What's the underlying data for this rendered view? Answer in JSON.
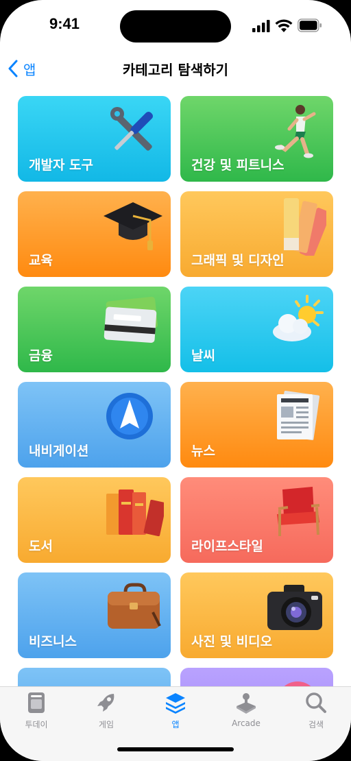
{
  "status_bar": {
    "time": "9:41"
  },
  "nav": {
    "back_label": "앱",
    "title": "카테고리 탐색하기"
  },
  "categories": [
    {
      "label": "개발자 도구",
      "icon": "tools-icon"
    },
    {
      "label": "건강 및 피트니스",
      "icon": "runner-icon"
    },
    {
      "label": "교육",
      "icon": "graduation-cap-icon"
    },
    {
      "label": "그래픽 및 디자인",
      "icon": "color-swatch-icon"
    },
    {
      "label": "금융",
      "icon": "credit-card-icon"
    },
    {
      "label": "날씨",
      "icon": "sun-cloud-icon"
    },
    {
      "label": "내비게이션",
      "icon": "compass-arrow-icon"
    },
    {
      "label": "뉴스",
      "icon": "newspaper-icon"
    },
    {
      "label": "도서",
      "icon": "books-icon"
    },
    {
      "label": "라이프스타일",
      "icon": "armchair-icon"
    },
    {
      "label": "비즈니스",
      "icon": "briefcase-icon"
    },
    {
      "label": "사진 및 비디오",
      "icon": "camera-icon"
    }
  ],
  "tabs": [
    {
      "label": "투데이",
      "icon": "today-icon"
    },
    {
      "label": "게임",
      "icon": "rocket-icon"
    },
    {
      "label": "앱",
      "icon": "apps-stack-icon"
    },
    {
      "label": "Arcade",
      "icon": "joystick-icon"
    },
    {
      "label": "검색",
      "icon": "search-icon"
    }
  ],
  "colors": {
    "accent": "#0a84ff",
    "inactive_tab": "#8e8e93"
  }
}
